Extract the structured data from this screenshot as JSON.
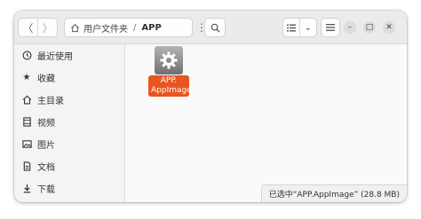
{
  "window": {
    "title": "APP"
  },
  "header": {
    "back_icon": "chevron-left-icon",
    "forward_icon": "chevron-right-icon",
    "path": [
      "用户文件夹",
      "APP"
    ],
    "path_separator": "/",
    "search_icon": "search-icon",
    "view_icon": "list-view-icon",
    "menu_icon": "hamburger-menu-icon"
  },
  "sidebar": {
    "items": [
      {
        "label": "最近使用",
        "icon": "clock-icon"
      },
      {
        "label": "收藏",
        "icon": "star-icon"
      },
      {
        "label": "主目录",
        "icon": "home-icon"
      },
      {
        "label": "视频",
        "icon": "video-icon"
      },
      {
        "label": "图片",
        "icon": "image-icon"
      },
      {
        "label": "文档",
        "icon": "document-icon"
      },
      {
        "label": "下载",
        "icon": "download-icon"
      }
    ]
  },
  "files": [
    {
      "name_line1": "APP.",
      "name_line2": "AppImage",
      "icon": "gear-icon",
      "selected": true
    }
  ],
  "status": {
    "text": "已选中“APP.AppImage” (28.8 MB)"
  },
  "colors": {
    "accent": "#e95420",
    "header_bg": "#ebebeb",
    "sidebar_bg": "#f4f4f4"
  }
}
